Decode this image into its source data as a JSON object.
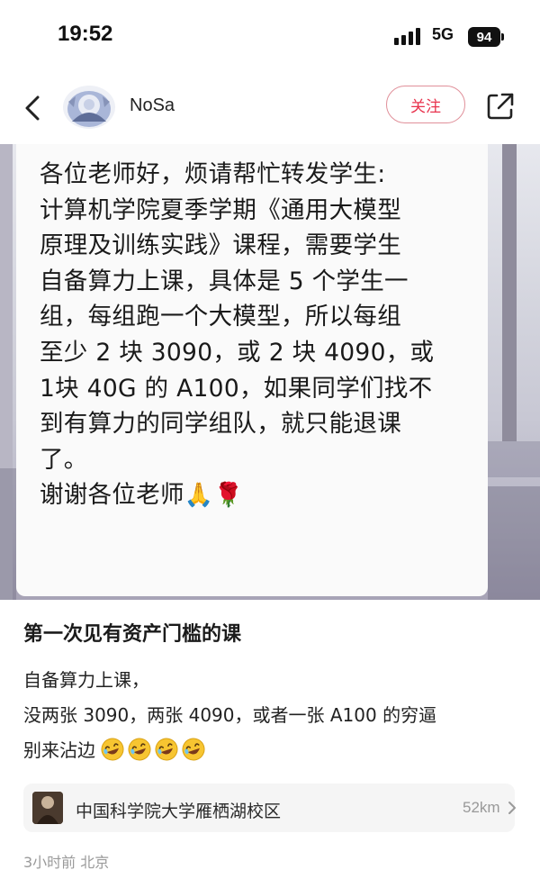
{
  "status_bar": {
    "time": "19:52",
    "network": "5G",
    "battery": "94"
  },
  "nav": {
    "username": "NoSa",
    "follow_label": "关注",
    "icons": {
      "back": "back-icon",
      "avatar": "avatar",
      "share": "share-icon"
    }
  },
  "message": {
    "lines": [
      "各位老师好，烦请帮忙转发学生:",
      "计算机学院夏季学期《通用大模型",
      "原理及训练实践》课程，需要学生",
      "自备算力上课，具体是 5 个学生一",
      "组，每组跑一个大模型，所以每组",
      "至少 2 块 3090，或 2 块 4090，或",
      "1块 40G 的 A100，如果同学们找不",
      "到有算力的同学组队，就只能退课",
      "了。",
      "谢谢各位老师"
    ],
    "emojis": [
      "🙏",
      "🌹"
    ]
  },
  "post": {
    "title": "第一次见有资产门槛的课",
    "body_lines": [
      "自备算力上课，",
      "没两张 3090，两张 4090，或者一张 A100 的穷逼",
      "别来沾边"
    ],
    "emoji_count": 4
  },
  "location": {
    "name": "中国科学院大学雁栖湖校区",
    "distance": "52km"
  },
  "meta": {
    "time_place": "3小时前 北京"
  },
  "colors": {
    "accent": "#e8344e",
    "follow_border": "#e0909a",
    "card_bg": "#f5f5f5",
    "meta_text": "#9a9a9a"
  }
}
